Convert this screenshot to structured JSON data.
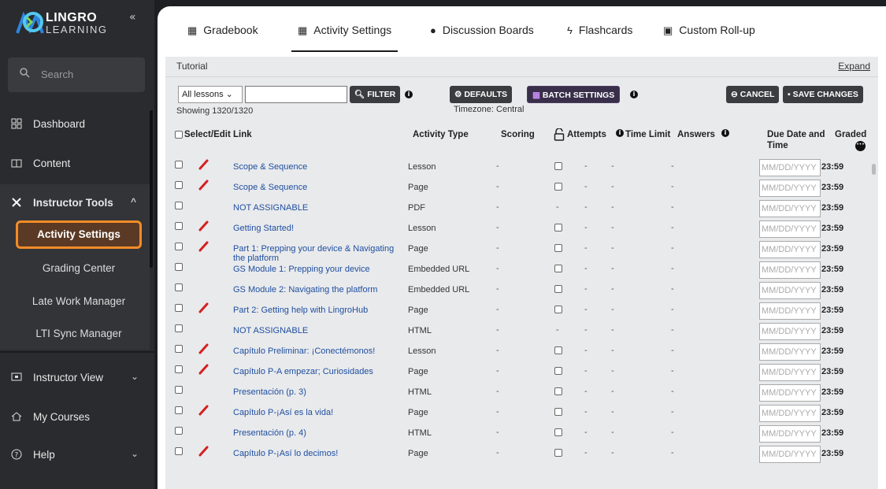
{
  "brand": {
    "top": "LINGRO",
    "bottom": "LEARNING",
    "collapse": "«"
  },
  "search": {
    "placeholder": "Search"
  },
  "nav": {
    "dashboard": "Dashboard",
    "content": "Content",
    "instructor_tools": "Instructor Tools",
    "sub": [
      "Activity Settings",
      "Grading Center",
      "Late Work Manager",
      "LTI Sync Manager"
    ],
    "instructor_view": "Instructor View",
    "my_courses": "My Courses",
    "help": "Help"
  },
  "tabs": [
    {
      "label": "Gradebook",
      "icon": "▦"
    },
    {
      "label": "Activity Settings",
      "icon": "▦"
    },
    {
      "label": "Discussion Boards",
      "icon": "●"
    },
    {
      "label": "Flashcards",
      "icon": "ϟ"
    },
    {
      "label": "Custom Roll-up",
      "icon": "▣"
    }
  ],
  "tutorial": {
    "label": "Tutorial",
    "expand": "Expand"
  },
  "toolbar": {
    "lessons": "All lessons",
    "filter": "FILTER",
    "defaults": "DEFAULTS",
    "batch": "BATCH SETTINGS",
    "cancel": "CANCEL",
    "save": "SAVE CHANGES",
    "showing": "Showing 1320/1320",
    "timezone": "Timezone: Central"
  },
  "columns": {
    "select": "Select/Edit Link",
    "type": "Activity Type",
    "scoring": "Scoring",
    "attempts": "Attempts",
    "time_limit": "Time Limit",
    "answers": "Answers",
    "due_line1": "Due Date and",
    "due_line2": "Time",
    "graded": "Graded"
  },
  "date_placeholder": "MM/DD/YYYY",
  "rows": [
    {
      "name": "Scope & Sequence",
      "type": "Lesson",
      "edit": true,
      "assignable": true,
      "time": "23:59"
    },
    {
      "name": "Scope & Sequence",
      "type": "Page",
      "edit": true,
      "assignable": true,
      "time": "23:59"
    },
    {
      "name": "NOT ASSIGNABLE",
      "type": "PDF",
      "edit": false,
      "assignable": false,
      "time": "23:59"
    },
    {
      "name": "Getting Started!",
      "type": "Lesson",
      "edit": true,
      "assignable": true,
      "time": "23:59"
    },
    {
      "name": "Part 1: Prepping your device & Navigating the platform",
      "type": "Page",
      "edit": true,
      "assignable": true,
      "time": "23:59"
    },
    {
      "name": "GS Module 1: Prepping your device",
      "type": "Embedded URL",
      "edit": false,
      "assignable": true,
      "time": "23:59"
    },
    {
      "name": "GS Module 2: Navigating the platform",
      "type": "Embedded URL",
      "edit": false,
      "assignable": true,
      "time": "23:59"
    },
    {
      "name": "Part 2: Getting help with LingroHub",
      "type": "Page",
      "edit": true,
      "assignable": true,
      "time": "23:59"
    },
    {
      "name": "NOT ASSIGNABLE",
      "type": "HTML",
      "edit": false,
      "assignable": false,
      "time": "23:59"
    },
    {
      "name": "Capítulo Preliminar: ¡Conectémonos!",
      "type": "Lesson",
      "edit": true,
      "assignable": true,
      "time": "23:59"
    },
    {
      "name": "Capítulo P-A empezar; Curiosidades",
      "type": "Page",
      "edit": true,
      "assignable": true,
      "time": "23:59"
    },
    {
      "name": "Presentación (p. 3)",
      "type": "HTML",
      "edit": false,
      "assignable": true,
      "time": "23:59"
    },
    {
      "name": "Capítulo P-¡Así es la vida!",
      "type": "Page",
      "edit": true,
      "assignable": true,
      "time": "23:59"
    },
    {
      "name": "Presentación (p. 4)",
      "type": "HTML",
      "edit": false,
      "assignable": true,
      "time": "23:59"
    },
    {
      "name": "Capítulo P-¡Así lo decimos!",
      "type": "Page",
      "edit": true,
      "assignable": true,
      "time": "23:59"
    }
  ],
  "colors": {
    "accent": "#f28c28",
    "link": "#1f4fa0",
    "sidebar": "#2a2b2e"
  }
}
